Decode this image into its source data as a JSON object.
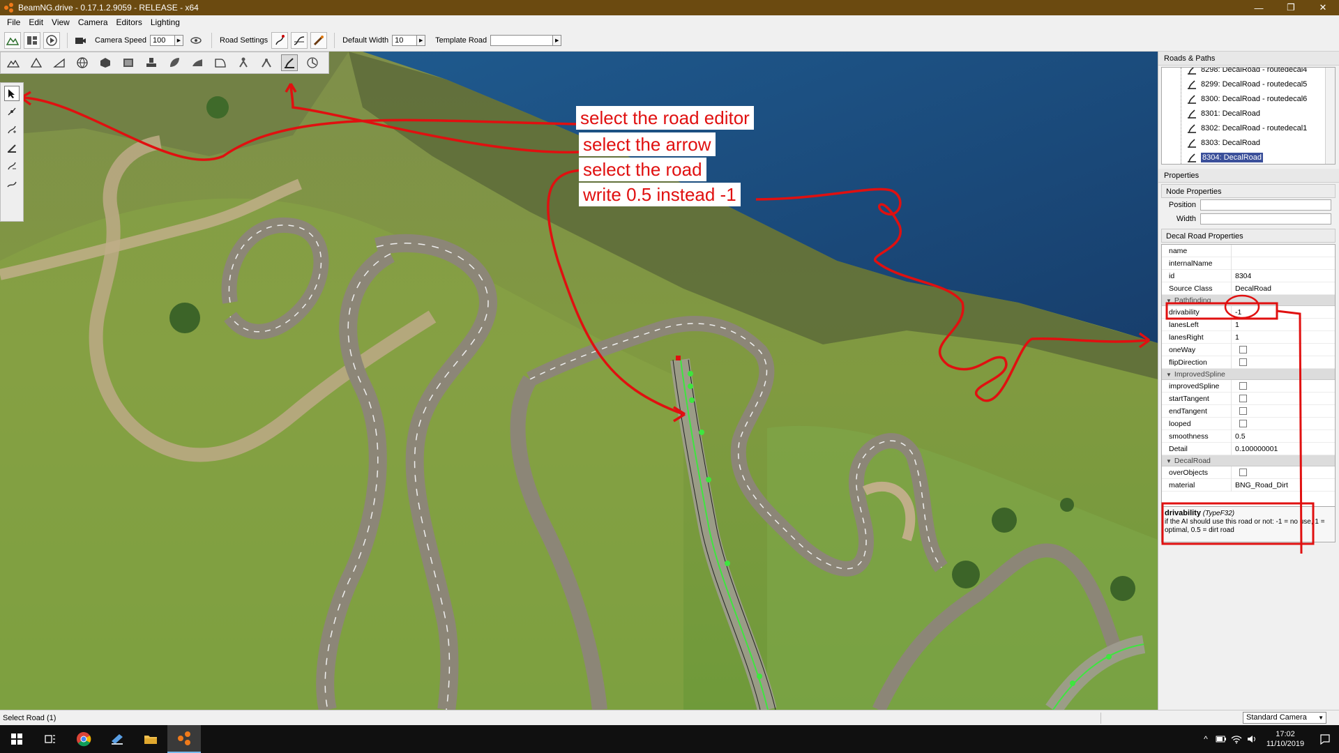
{
  "window": {
    "title": "BeamNG.drive - 0.17.1.2.9059 - RELEASE - x64",
    "buttons": {
      "minimize": "—",
      "restore": "❐",
      "close": "✕"
    }
  },
  "menu": [
    "File",
    "Edit",
    "View",
    "Camera",
    "Editors",
    "Lighting"
  ],
  "toolbar": {
    "camera_speed_label": "Camera Speed",
    "camera_speed_value": "100",
    "road_settings_label": "Road Settings",
    "default_width_label": "Default Width",
    "default_width_value": "10",
    "template_road_label": "Template Road",
    "template_road_value": ""
  },
  "annotations": {
    "note1": "select the road editor",
    "note2": "select the arrow",
    "note3": "select the road",
    "note4": "write 0.5 instead -1",
    "annotation_color": "#e01010"
  },
  "roads_panel": {
    "title": "Roads & Paths",
    "items": [
      {
        "label": "8298: DecalRoad - routedecal4",
        "selected": false
      },
      {
        "label": "8299: DecalRoad - routedecal5",
        "selected": false
      },
      {
        "label": "8300: DecalRoad - routedecal6",
        "selected": false
      },
      {
        "label": "8301: DecalRoad",
        "selected": false
      },
      {
        "label": "8302: DecalRoad - routedecal1",
        "selected": false
      },
      {
        "label": "8303: DecalRoad",
        "selected": false
      },
      {
        "label": "8304: DecalRoad",
        "selected": true
      }
    ]
  },
  "properties": {
    "title": "Properties",
    "node_title": "Node Properties",
    "position_label": "Position",
    "width_label": "Width",
    "decal_title": "Decal Road Properties",
    "rows_general": [
      {
        "name": "name",
        "value": ""
      },
      {
        "name": "internalName",
        "value": ""
      },
      {
        "name": "id",
        "value": "8304"
      },
      {
        "name": "Source Class",
        "value": "DecalRoad"
      }
    ],
    "group_pathfinding": "Pathfinding",
    "rows_pathfinding": [
      {
        "name": "drivability",
        "value": "-1"
      },
      {
        "name": "lanesLeft",
        "value": "1"
      },
      {
        "name": "lanesRight",
        "value": "1"
      }
    ],
    "oneway_label": "oneWay",
    "flipdirection_label": "flipDirection",
    "group_spline": "ImprovedSpline",
    "improvedspline_label": "improvedSpline",
    "starttangent_label": "startTangent",
    "endtangent_label": "endTangent",
    "looped_label": "looped",
    "smoothness_label": "smoothness",
    "smoothness_value": "0.5",
    "detail_label": "Detail",
    "detail_value": "0.100000001",
    "group_decal": "DecalRoad",
    "overobjects_label": "overObjects",
    "material_label": "material",
    "material_value": "BNG_Road_Dirt"
  },
  "tooltip": {
    "title": "drivability",
    "type": "(TypeF32)",
    "text": "if the AI should use this road or not: -1 = no use, 1 = optimal, 0.5 = dirt road"
  },
  "status": {
    "text": "Select Road (1)",
    "camera_mode": "Standard Camera"
  },
  "taskbar": {
    "time": "17:02",
    "date": "11/10/2019"
  }
}
